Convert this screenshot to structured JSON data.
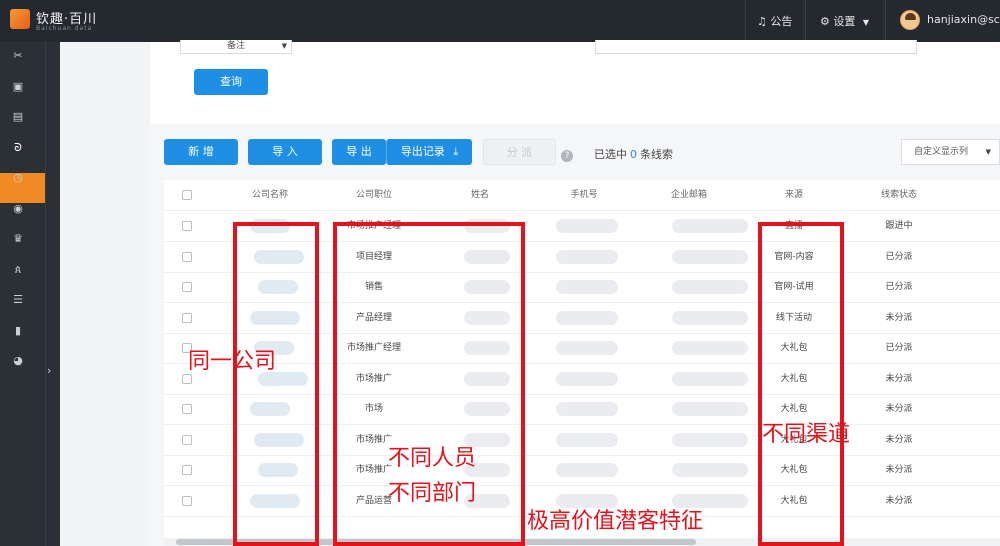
{
  "topbar": {
    "brand": "钦趣·百川",
    "brand_sub": "Baichuan data",
    "notice": "公告",
    "settings": "设置",
    "username": "hanjiaxin@scr..."
  },
  "filters": {
    "remark_select": "备注",
    "query_button": "查询"
  },
  "toolbar": {
    "add": "新 增",
    "import": "导 入",
    "export": "导 出",
    "export_log": "导出记录",
    "assign": "分 派",
    "selected_prefix": "已选中",
    "selected_count": "0",
    "selected_suffix": "条线索",
    "custom_columns": "自定义显示列"
  },
  "table": {
    "headers": [
      "公司名称",
      "公司职位",
      "姓名",
      "手机号",
      "企业邮箱",
      "来源",
      "线索状态"
    ],
    "rows": [
      {
        "position": "市场推广经理",
        "source": "直播",
        "status": "跟进中"
      },
      {
        "position": "项目经理",
        "source": "官网-内容",
        "status": "已分派"
      },
      {
        "position": "销售",
        "source": "官网-试用",
        "status": "已分派"
      },
      {
        "position": "产品经理",
        "source": "线下活动",
        "status": "未分派"
      },
      {
        "position": "市场推广经理",
        "source": "大礼包",
        "status": "已分派"
      },
      {
        "position": "市场推广",
        "source": "大礼包",
        "status": "未分派"
      },
      {
        "position": "市场",
        "source": "大礼包",
        "status": "未分派"
      },
      {
        "position": "市场推广",
        "source": "大礼包",
        "status": "未分派"
      },
      {
        "position": "市场推广",
        "source": "大礼包",
        "status": "未分派"
      },
      {
        "position": "产品运营",
        "source": "大礼包",
        "status": "未分派"
      }
    ]
  },
  "annotations": {
    "same_company": "同一公司",
    "diff_people": "不同人员",
    "diff_dept": "不同部门",
    "diff_channel": "不同渠道",
    "high_value": "极高价值潜客特征"
  },
  "colors": {
    "accent": "#1f8fe6",
    "sidebar_active": "#f08a24",
    "annotation_red": "#e3131b"
  }
}
